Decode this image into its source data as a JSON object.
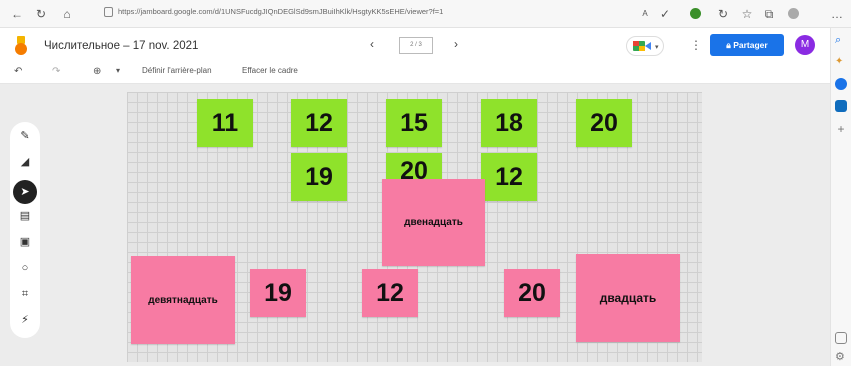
{
  "browser": {
    "url": "https://jamboard.google.com/d/1UNSFucdgJIQnDEGlSd9smJBuiIhKlk/HsgtyKK5sEHE/viewer?f=1"
  },
  "app": {
    "title": "Числительное – 17 nov. 2021",
    "page_indicator": "2 / 3",
    "share_label": "Partager",
    "avatar_letter": "M"
  },
  "toolbar": {
    "set_background": "Définir l'arrière-plan",
    "clear_frame": "Effacer le cadre"
  },
  "notes": {
    "n11": "11",
    "n12a": "12",
    "n15": "15",
    "n18": "18",
    "n20a": "20",
    "n19a": "19",
    "n20b": "20",
    "n12b": "12",
    "dvenadcat": "двенадцать",
    "devyatnadcat": "девятнадцать",
    "n19b": "19",
    "n12c": "12",
    "n20c": "20",
    "dvadcat": "двадцать"
  },
  "colors": {
    "green_note": "#8fe22b",
    "pink_note": "#f77ba3",
    "share_button": "#1a73e8",
    "avatar": "#8a2be2"
  }
}
